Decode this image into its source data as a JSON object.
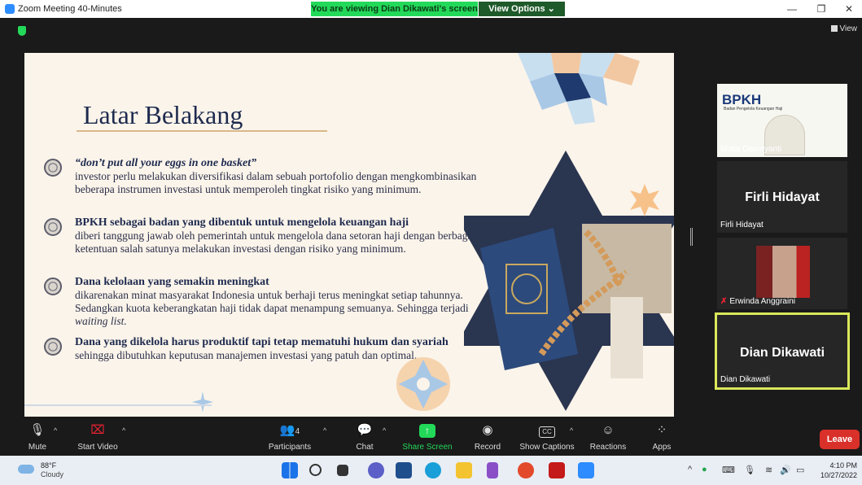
{
  "window": {
    "title": "Zoom Meeting 40-Minutes",
    "viewing_banner": "You are viewing Dian Dikawati's screen",
    "view_options": "View Options ⌄"
  },
  "meeting": {
    "view_label": "View"
  },
  "slide": {
    "title": "Latar Belakang",
    "bullets": [
      {
        "heading": "“don’t put all your eggs in one basket”",
        "body": "investor perlu melakukan diversifikasi dalam sebuah portofolio dengan mengkombinasikan beberapa instrumen investasi untuk memperoleh tingkat risiko yang minimum."
      },
      {
        "heading": "BPKH sebagai badan yang dibentuk untuk mengelola keuangan haji",
        "body": "diberi tanggung jawab oleh pemerintah untuk mengelola dana setoran haji dengan berbagai ketentuan salah satunya melakukan investasi dengan risiko yang minimum."
      },
      {
        "heading": "Dana kelolaan yang semakin meningkat",
        "body": "dikarenakan minat masyarakat Indonesia untuk berhaji terus meningkat setiap tahunnya. Sedangkan kuota keberangkatan haji tidak dapat menampung semuanya. Sehingga terjadi",
        "body_italic": "waiting list."
      },
      {
        "heading": "Dana yang dikelola harus produktif tapi tetap mematuhi hukum dan syariah",
        "body": "sehingga dibutuhkan keputusan manajemen investasi yang patuh dan optimal."
      }
    ]
  },
  "participants": [
    {
      "name": "Mutia Damayanti",
      "logo": "BPKH",
      "logo_sub": "Badan Pengelola Keuangan Haji"
    },
    {
      "name": "Firli Hidayat",
      "display": "Firli Hidayat"
    },
    {
      "name": "Erwinda Anggraini"
    },
    {
      "name": "Dian Dikawati",
      "display": "Dian Dikawati"
    }
  ],
  "toolbar": {
    "mute": "Mute",
    "start_video": "Start Video",
    "participants": "Participants",
    "participants_count": "4",
    "chat": "Chat",
    "share_screen": "Share Screen",
    "record": "Record",
    "show_captions": "Show Captions",
    "reactions": "Reactions",
    "apps": "Apps",
    "leave": "Leave",
    "cc": "CC"
  },
  "taskbar": {
    "temp": "88°F",
    "condition": "Cloudy",
    "time": "4:10 PM",
    "date": "10/27/2022"
  },
  "colors": {
    "zoom_green": "#23d959",
    "slide_bg": "#fbf4ea",
    "slide_navy": "#1e2a4f",
    "leave_red": "#d9302a",
    "active_border": "#d9e85a"
  }
}
